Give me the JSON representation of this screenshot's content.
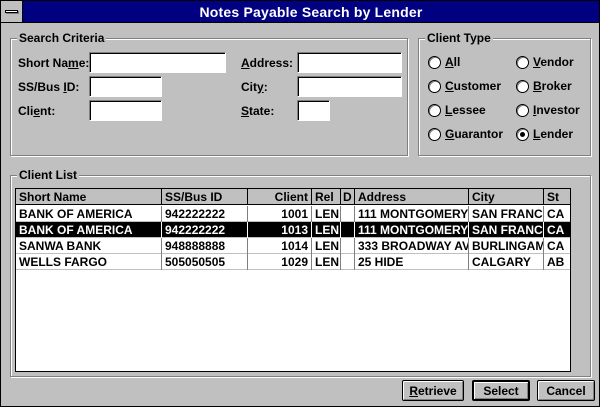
{
  "window": {
    "title": "Notes Payable Search by Lender"
  },
  "search_criteria": {
    "legend": "Search Criteria",
    "fields": {
      "short_name": {
        "label_pre": "Short Na",
        "label_ul": "m",
        "label_post": "e:",
        "value": ""
      },
      "ssbus_id": {
        "label_pre": "SS/Bus ",
        "label_ul": "I",
        "label_post": "D:",
        "value": ""
      },
      "client": {
        "label_pre": "Cli",
        "label_ul": "e",
        "label_post": "nt:",
        "value": ""
      },
      "address": {
        "label_pre": "",
        "label_ul": "A",
        "label_post": "ddress:",
        "value": ""
      },
      "city": {
        "label_pre": "Cit",
        "label_ul": "y",
        "label_post": ":",
        "value": ""
      },
      "state": {
        "label_pre": "",
        "label_ul": "S",
        "label_post": "tate:",
        "value": ""
      }
    }
  },
  "client_type": {
    "legend": "Client Type",
    "options": [
      {
        "label": "All",
        "ul": "A",
        "rest": "ll",
        "selected": false
      },
      {
        "label": "Vendor",
        "ul": "V",
        "rest": "endor",
        "selected": false
      },
      {
        "label": "Customer",
        "ul": "C",
        "rest": "ustomer",
        "selected": false
      },
      {
        "label": "Broker",
        "ul": "B",
        "rest": "roker",
        "selected": false
      },
      {
        "label": "Lessee",
        "ul": "L",
        "rest": "essee",
        "selected": false
      },
      {
        "label": "Investor",
        "ul": "I",
        "rest": "nvestor",
        "selected": false
      },
      {
        "label": "Guarantor",
        "ul": "G",
        "rest": "uarantor",
        "selected": false
      },
      {
        "label": "Lender",
        "ul": "L",
        "rest": "ender",
        "selected": true
      }
    ]
  },
  "client_list": {
    "legend": "Client List",
    "columns": [
      "Short Name",
      "SS/Bus ID",
      "Client",
      "Rel",
      "D",
      "Address",
      "City",
      "St"
    ],
    "rows": [
      [
        "BANK OF AMERICA",
        "942222222",
        "1001",
        "LEN",
        "",
        "111 MONTGOMERY",
        "SAN FRANC",
        "CA"
      ],
      [
        "BANK OF AMERICA",
        "942222222",
        "1013",
        "LEN",
        "",
        "111 MONTGOMERY",
        "SAN FRANC",
        "CA"
      ],
      [
        "SANWA BANK",
        "948888888",
        "1014",
        "LEN",
        "",
        "333 BROADWAY AV",
        "BURLINGAM",
        "CA"
      ],
      [
        "WELLS FARGO",
        "505050505",
        "1029",
        "LEN",
        "",
        "25 HIDE",
        "CALGARY",
        "AB"
      ]
    ],
    "selected_row": 1
  },
  "buttons": {
    "retrieve": {
      "ul": "R",
      "rest": "etrieve"
    },
    "select": {
      "label": "Select"
    },
    "cancel": {
      "label": "Cancel"
    }
  }
}
